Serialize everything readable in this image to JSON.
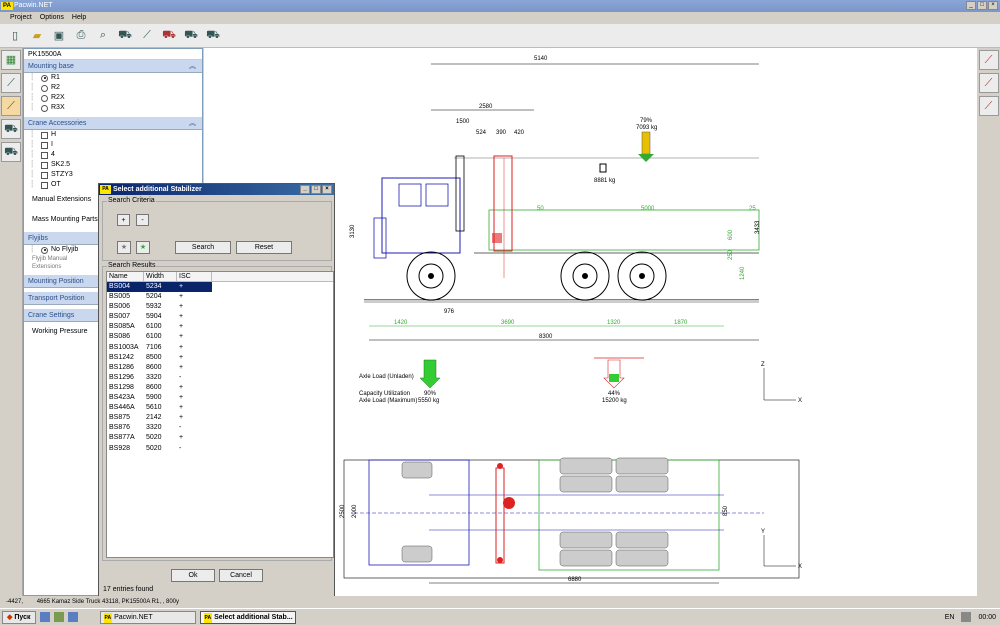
{
  "app": {
    "title": "Pacwin.NET",
    "icon_label": "PA"
  },
  "menu": [
    "Project",
    "Options",
    "Help"
  ],
  "toolbar": [
    "new-icon",
    "open-icon",
    "save-icon",
    "print-icon",
    "zoom-icon",
    "truck-icon",
    "crane-icon",
    "truck2-icon",
    "truck3-icon",
    "truck4-icon"
  ],
  "panel": {
    "model": "PK15500A",
    "mounting_base": {
      "title": "Mounting base",
      "options": [
        "R1",
        "R2",
        "R2X",
        "R3X"
      ],
      "selected": "R1"
    },
    "crane_accessories": {
      "title": "Crane Accessories",
      "items": [
        "H",
        "I",
        "4",
        "SK2.5",
        "STZY3",
        "OT"
      ]
    },
    "manual_extensions": "Manual Extensions",
    "mass_mounting_parts": "Mass Mounting Parts",
    "flyjibs": {
      "title": "Flyjibs",
      "option": "No Flyjib",
      "note": "Flyjib Manual Extensions"
    },
    "mounting_position": "Mounting Position",
    "transport_position": "Transport Position",
    "crane_settings": "Crane Settings",
    "working_pressure": "Working Pressure"
  },
  "dialog": {
    "title": "Select additional Stabilizer",
    "search_criteria": "Search Criteria",
    "plus_label": "+",
    "minus_label": "-",
    "search_label": "Search",
    "reset_label": "Reset",
    "search_results": "Search Results",
    "columns": [
      "Name",
      "Width",
      "ISC"
    ],
    "rows": [
      [
        "BS004",
        "5234",
        "+"
      ],
      [
        "BS005",
        "5204",
        "+"
      ],
      [
        "BS006",
        "5932",
        "+"
      ],
      [
        "BS007",
        "5904",
        "+"
      ],
      [
        "BS085A",
        "6100",
        "+"
      ],
      [
        "BS086",
        "6100",
        "+"
      ],
      [
        "BS1003A",
        "7106",
        "+"
      ],
      [
        "BS1242",
        "8500",
        "+"
      ],
      [
        "BS1286",
        "8600",
        "+"
      ],
      [
        "BS1296",
        "3320",
        "-"
      ],
      [
        "BS1298",
        "8600",
        "+"
      ],
      [
        "BS423A",
        "5900",
        "+"
      ],
      [
        "BS446A",
        "5610",
        "+"
      ],
      [
        "BS875",
        "2142",
        "+"
      ],
      [
        "BS876",
        "3320",
        "-"
      ],
      [
        "BS877A",
        "5020",
        "+"
      ],
      [
        "BS928",
        "5020",
        "-"
      ]
    ],
    "selected_row": 0,
    "count_text": "17 entries found",
    "ok_label": "Ok",
    "cancel_label": "Cancel"
  },
  "drawing": {
    "dims_top": [
      "5140",
      "2580",
      "1500",
      "524",
      "390",
      "420",
      "5000",
      "50",
      "25"
    ],
    "dims_bottom": [
      "1420",
      "976",
      "3690",
      "1320",
      "1870",
      "8300"
    ],
    "dims_side": [
      "3130",
      "3433",
      "600",
      "1240",
      "250"
    ],
    "load_top": {
      "pct": "79%",
      "kg": "7093 kg"
    },
    "center_mass": "8881 kg",
    "axle_load_unladen": "Axle Load (Unladen)",
    "capacity_utilization": "Capacity Utilization",
    "axle_load_max": "Axle Load (Maximum)",
    "front_pct": "90%",
    "front_kg": "5550 kg",
    "rear_pct": "44%",
    "rear_kg": "15200 kg",
    "plan_dims": [
      "2500",
      "2000",
      "6880",
      "850"
    ],
    "axes": [
      "Z",
      "X",
      "Y",
      "X"
    ]
  },
  "status": {
    "coords": "-4427,",
    "info": "4665 Kamaz Side Truck 43118, PK15500A R1, , 800y"
  },
  "taskbar": {
    "start": "Пуск",
    "tasks": [
      "Pacwin.NET",
      "Select additional Stab..."
    ],
    "lang": "EN",
    "time": "00:00"
  }
}
